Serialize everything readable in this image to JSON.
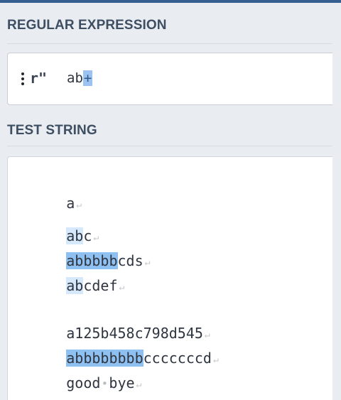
{
  "regex_section": {
    "title": "REGULAR EXPRESSION",
    "flavor_menu_icon": "vertical-dots-icon",
    "delimiter": "r\"",
    "pattern_literal": "ab",
    "pattern_quantifier": "+"
  },
  "test_section": {
    "title": "TEST STRING",
    "lines": [
      {
        "before": "a",
        "match": "",
        "after": ""
      },
      {
        "before": "",
        "match": "ab",
        "after": "c"
      },
      {
        "before": "",
        "match": "abbbbb",
        "after": "cds"
      },
      {
        "before": "",
        "match": "ab",
        "after": "cdef"
      },
      {
        "before": "a125b458c798d545",
        "match": "",
        "after": ""
      },
      {
        "before": "",
        "match": "abbbbbbbb",
        "after": "cccccccd"
      },
      {
        "before": "good",
        "match": "",
        "after": "",
        "space_marker": "•",
        "tail": "bye"
      }
    ]
  },
  "symbols": {
    "line_end": "↵"
  },
  "colors": {
    "accent_bar": "#355f8f",
    "match_light": "#d6e8fb",
    "match_dark": "#8fc0f2",
    "quantifier_highlight": "#9bc2f1"
  }
}
